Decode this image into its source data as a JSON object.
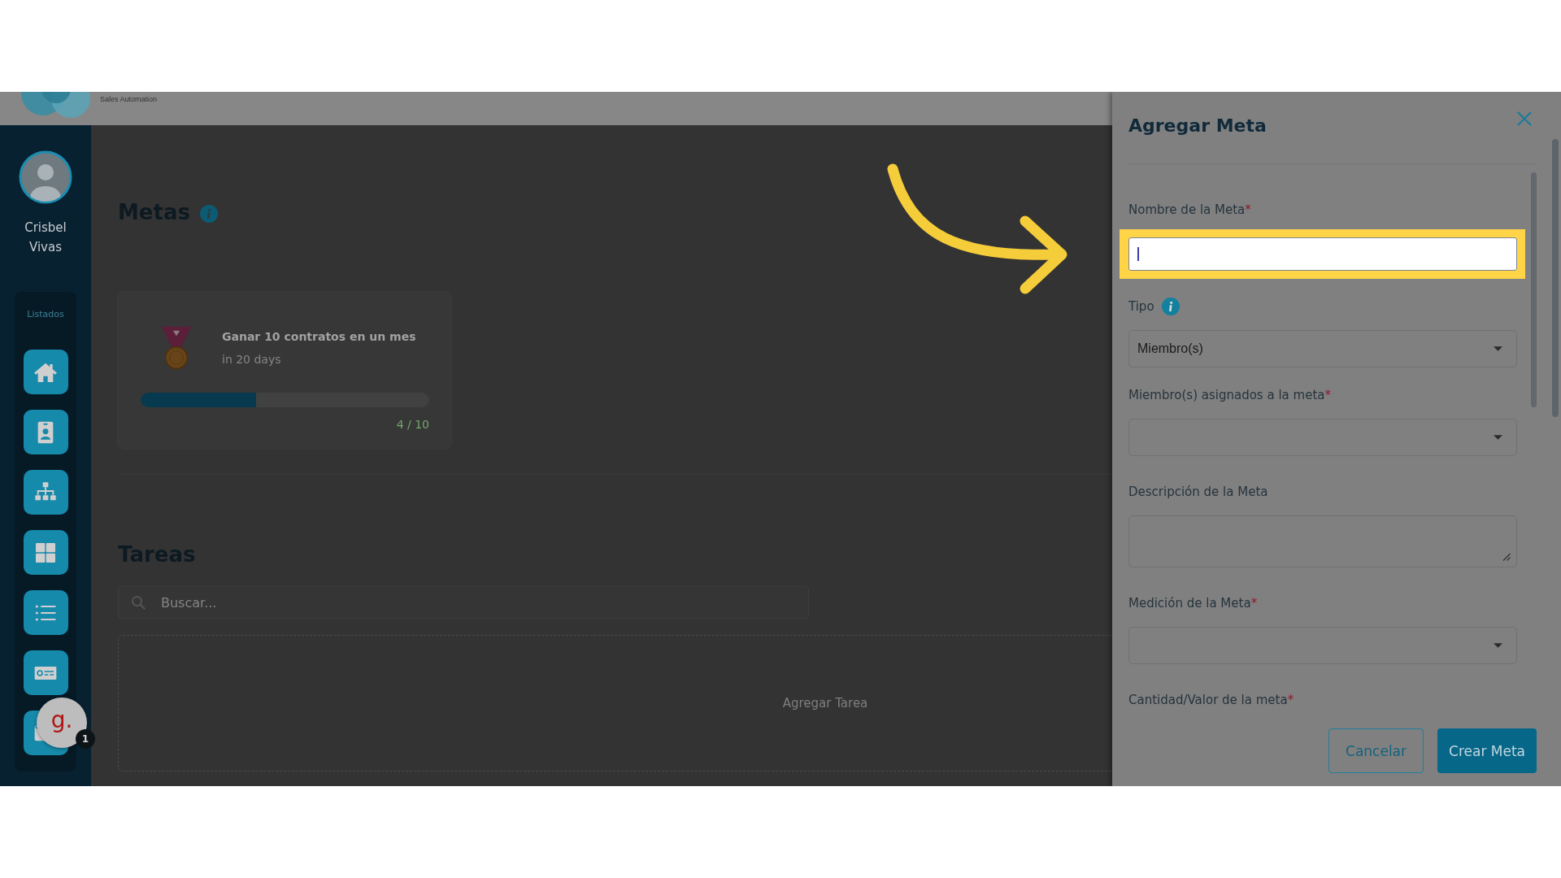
{
  "header": {
    "logo_text": "Sales Automation"
  },
  "sidebar": {
    "user": {
      "name": "Crisbel Vivas"
    },
    "section_label": "Listados",
    "items": [
      {
        "kind": "home"
      },
      {
        "kind": "badge"
      },
      {
        "kind": "hierarchy"
      },
      {
        "kind": "grid"
      },
      {
        "kind": "list"
      },
      {
        "kind": "bill"
      },
      {
        "kind": "mail"
      }
    ]
  },
  "chat_widget": {
    "logo": "g.",
    "badge": "1"
  },
  "goals": {
    "title": "Metas",
    "cards": [
      {
        "title": "Ganar 10 contratos en un mes",
        "due": "in 20 days",
        "level": 0.4,
        "progress": "4 / 10"
      }
    ]
  },
  "tasks": {
    "title": "Tareas",
    "search": {
      "placeholder": "Buscar..."
    },
    "add_label": "Agregar Tarea"
  },
  "panel": {
    "title": "Agregar Meta",
    "fields": [
      {
        "kind": "text",
        "label": "Nombre de la Meta",
        "required_mark": "*",
        "info": false,
        "focused": true,
        "highlighted": true
      },
      {
        "kind": "select",
        "label": "Tipo",
        "info": true,
        "value": "Miembro(s)",
        "highlighted": false
      },
      {
        "kind": "select",
        "label": "Miembro(s) asignados a la meta",
        "required_mark": "*",
        "info": false,
        "highlighted": false
      },
      {
        "kind": "textarea",
        "label": "Descripción de la Meta",
        "info": false,
        "highlighted": false
      },
      {
        "kind": "select",
        "label": "Medición de la Meta",
        "required_mark": "*",
        "info": false,
        "highlighted": false
      },
      {
        "kind": "label",
        "label": "Cantidad/Valor de la meta",
        "required_mark": "*",
        "info": false
      }
    ],
    "buttons": [
      {
        "kind": "secondary",
        "label": "Cancelar"
      },
      {
        "kind": "primary",
        "label": "Crear Meta"
      }
    ]
  },
  "annotations": [
    {
      "kind": "curved-arrow"
    }
  ]
}
